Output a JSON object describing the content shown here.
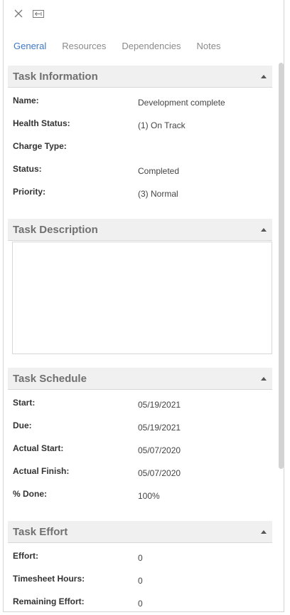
{
  "toolbar": {
    "close_icon": "close-icon",
    "popout_icon": "popout-icon"
  },
  "tabs": [
    {
      "label": "General",
      "active": true
    },
    {
      "label": "Resources",
      "active": false
    },
    {
      "label": "Dependencies",
      "active": false
    },
    {
      "label": "Notes",
      "active": false
    }
  ],
  "task_information": {
    "title": "Task Information",
    "fields": [
      {
        "label": "Name:",
        "value": "Development complete"
      },
      {
        "label": "Health Status:",
        "value": "(1) On Track"
      },
      {
        "label": "Charge Type:",
        "value": ""
      },
      {
        "label": "Status:",
        "value": "Completed"
      },
      {
        "label": "Priority:",
        "value": "(3) Normal"
      }
    ]
  },
  "task_description": {
    "title": "Task Description",
    "text": ""
  },
  "task_schedule": {
    "title": "Task Schedule",
    "fields": [
      {
        "label": "Start:",
        "value": "05/19/2021"
      },
      {
        "label": "Due:",
        "value": "05/19/2021"
      },
      {
        "label": "Actual Start:",
        "value": "05/07/2020"
      },
      {
        "label": "Actual Finish:",
        "value": "05/07/2020"
      },
      {
        "label": "% Done:",
        "value": "100%"
      }
    ]
  },
  "task_effort": {
    "title": "Task Effort",
    "fields": [
      {
        "label": "Effort:",
        "value": "0"
      },
      {
        "label": "Timesheet Hours:",
        "value": "0"
      },
      {
        "label": "Remaining Effort:",
        "value": "0"
      }
    ]
  },
  "colors": {
    "accent": "#3f78c4",
    "section_header_bg": "#f0f0f0",
    "section_title": "#707070"
  }
}
